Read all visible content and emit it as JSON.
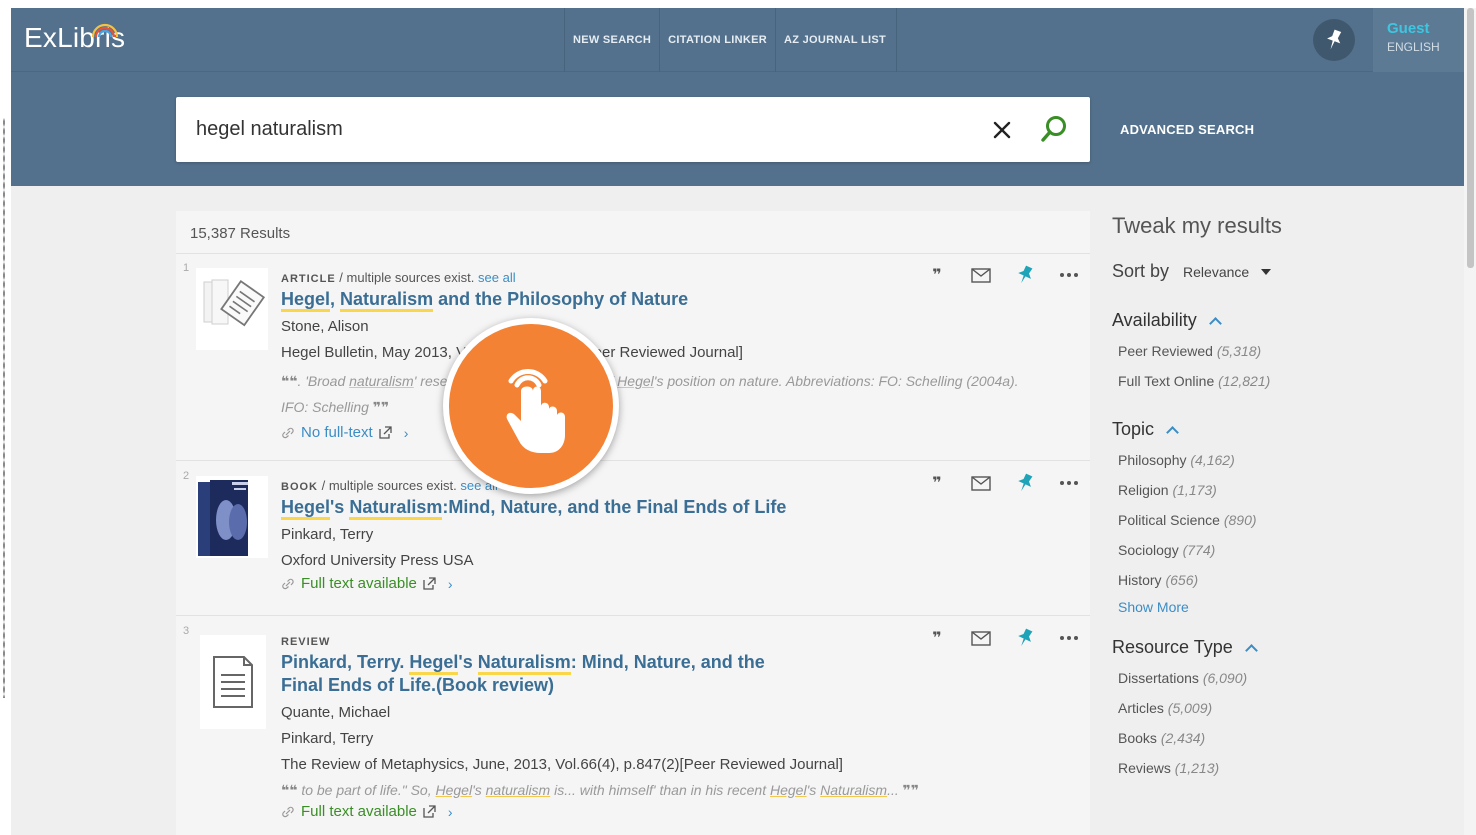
{
  "header": {
    "logo": "ExLibris",
    "nav": [
      "NEW SEARCH",
      "CITATION LINKER",
      "AZ JOURNAL LIST"
    ],
    "user": {
      "name": "Guest",
      "language": "ENGLISH"
    }
  },
  "search": {
    "query": "hegel naturalism",
    "advanced_label": "ADVANCED SEARCH"
  },
  "results": {
    "count_label": "15,387 Results",
    "items": [
      {
        "number": "1",
        "type": "ARTICLE",
        "type_suffix": "/ multiple sources exist.",
        "see_all": "see all",
        "title_parts": [
          "Hegel",
          ", ",
          "Naturalism",
          " and the Philosophy of Nature"
        ],
        "author": "Stone, Alison",
        "source": "Hegel Bulletin, May 2013, Vol.34(1), p.59-78 [Peer Reviewed Journal]",
        "snippet_parts": [
          ". 'Broad ",
          "naturalism",
          "' resembles a further variation of ",
          "Hegel",
          "'s position on nature. Abbreviations: FO: Schelling (2004a). IFO: Schelling"
        ],
        "availability": "No full-text"
      },
      {
        "number": "2",
        "type": "BOOK",
        "type_suffix": "/ multiple sources exist.",
        "see_all": "see all",
        "title_parts": [
          "Hegel",
          "'s ",
          "Naturalism",
          ":Mind, Nature, and the Final Ends of Life"
        ],
        "author": "Pinkard, Terry",
        "source": "Oxford University Press USA",
        "availability": "Full text available"
      },
      {
        "number": "3",
        "type": "REVIEW",
        "title_parts": [
          "Pinkard, Terry. ",
          "Hegel",
          "'s ",
          "Naturalism",
          ": Mind, Nature, and the Final Ends of Life.(Book review)"
        ],
        "author": "Quante, Michael",
        "author2": "Pinkard, Terry",
        "source": "The Review of Metaphysics, June, 2013, Vol.66(4), p.847(2)[Peer Reviewed Journal]",
        "snippet_parts": [
          " to be part of life.\" So, ",
          "Hegel",
          "'s ",
          "naturalism",
          " is... with himself' than in his recent ",
          "Hegel",
          "'s ",
          "Naturalism",
          "... "
        ],
        "availability": "Full text available"
      }
    ]
  },
  "sidebar": {
    "title": "Tweak my results",
    "sort_label": "Sort by",
    "sort_value": "Relevance",
    "groups": [
      {
        "title": "Availability",
        "items": [
          {
            "label": "Peer Reviewed",
            "count": "(5,318)"
          },
          {
            "label": "Full Text Online",
            "count": "(12,821)"
          }
        ]
      },
      {
        "title": "Topic",
        "items": [
          {
            "label": "Philosophy",
            "count": "(4,162)"
          },
          {
            "label": "Religion",
            "count": "(1,173)"
          },
          {
            "label": "Political Science",
            "count": "(890)"
          },
          {
            "label": "Sociology",
            "count": "(774)"
          },
          {
            "label": "History",
            "count": "(656)"
          }
        ],
        "show_more": "Show More"
      },
      {
        "title": "Resource Type",
        "items": [
          {
            "label": "Dissertations",
            "count": "(6,090)"
          },
          {
            "label": "Articles",
            "count": "(5,009)"
          },
          {
            "label": "Books",
            "count": "(2,434)"
          },
          {
            "label": "Reviews",
            "count": "(1,213)"
          }
        ]
      }
    ]
  },
  "icons": {
    "action_icons": [
      "quote-icon",
      "email-icon",
      "pin-icon",
      "more-icon"
    ],
    "tap_overlay": "tap-hand-icon"
  },
  "colors": {
    "header": "#53718c",
    "accent_link": "#3c8dc5",
    "title_link": "#3b6e94",
    "available_green": "#3a8e26",
    "highlight": "#f9d64a",
    "pin_teal": "#1fa3b8",
    "tap_orange": "#f38234"
  }
}
